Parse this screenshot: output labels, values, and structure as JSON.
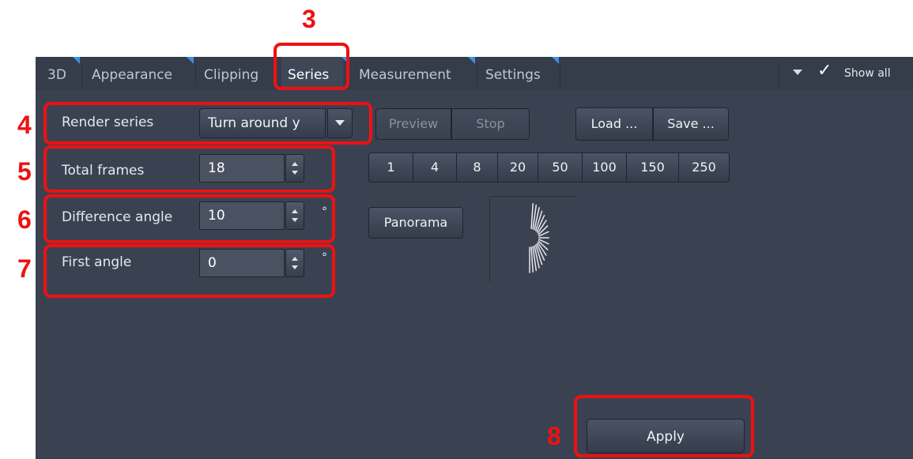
{
  "tabs": [
    {
      "label": "3D"
    },
    {
      "label": "Appearance"
    },
    {
      "label": "Clipping"
    },
    {
      "label": "Series"
    },
    {
      "label": "Measurement"
    },
    {
      "label": "Settings"
    }
  ],
  "header": {
    "show_all_label": "Show all"
  },
  "render_series": {
    "label": "Render series",
    "value": "Turn around y"
  },
  "buttons": {
    "preview": "Preview",
    "stop": "Stop",
    "load": "Load ...",
    "save": "Save ...",
    "panorama": "Panorama",
    "apply": "Apply"
  },
  "frame_presets": [
    "1",
    "4",
    "8",
    "20",
    "50",
    "100",
    "150",
    "250"
  ],
  "fields": {
    "total_frames": {
      "label": "Total frames",
      "value": "18"
    },
    "difference_angle": {
      "label": "Difference angle",
      "value": "10",
      "unit": "°"
    },
    "first_angle": {
      "label": "First angle",
      "value": "0",
      "unit": "°"
    }
  },
  "callouts": [
    "3",
    "4",
    "5",
    "6",
    "7",
    "8"
  ],
  "colors": {
    "panel": "#3a4252",
    "callout": "#ee1111",
    "tab_marker": "#3d8fe0"
  }
}
